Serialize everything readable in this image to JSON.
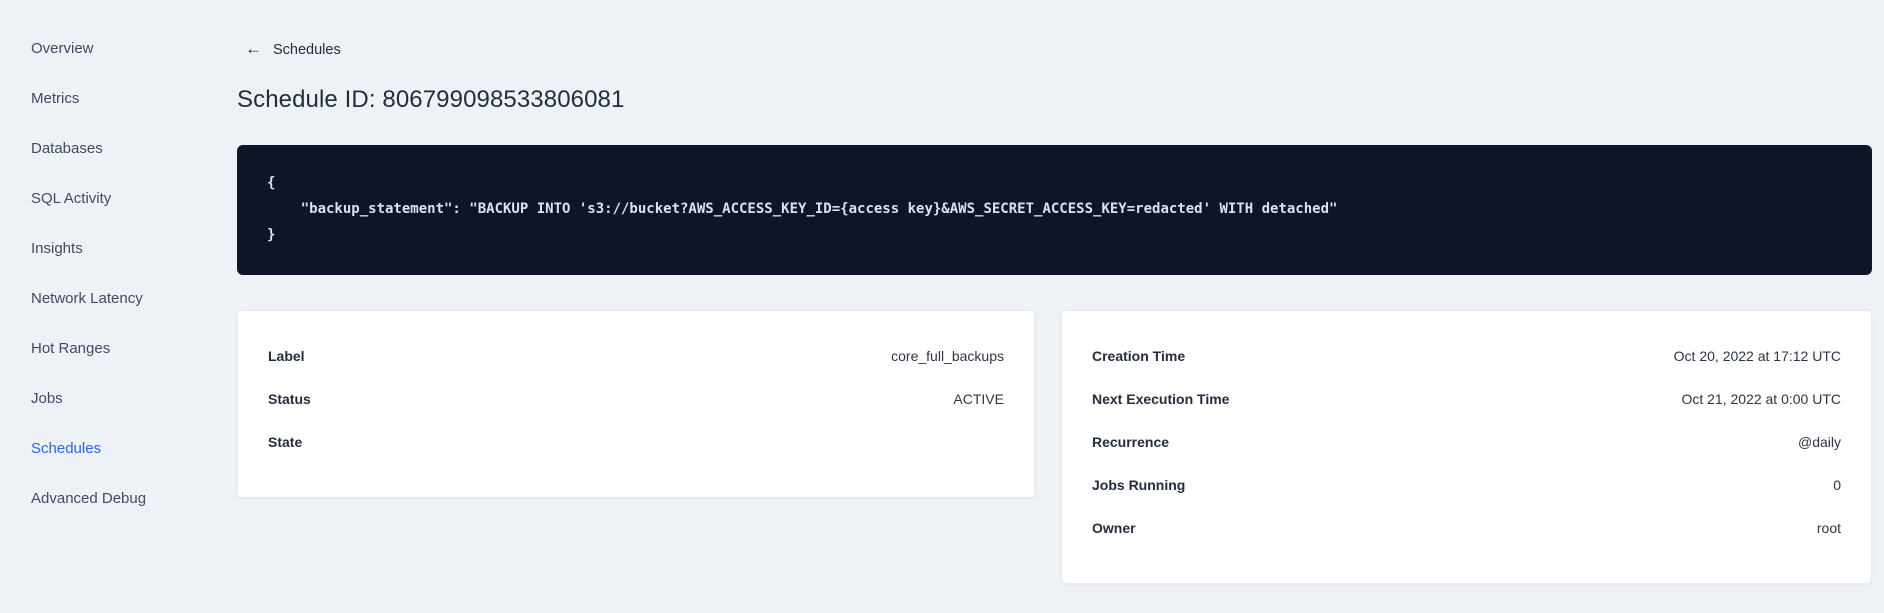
{
  "colors": {
    "page_background": "#eef2f6",
    "accent_active_link": "#2964ff",
    "code_background": "#0e1524",
    "code_text": "#dbe1ec",
    "card_background": "#ffffff"
  },
  "sidebar": {
    "items": [
      {
        "label": "Overview",
        "active": false
      },
      {
        "label": "Metrics",
        "active": false
      },
      {
        "label": "Databases",
        "active": false
      },
      {
        "label": "SQL Activity",
        "active": false
      },
      {
        "label": "Insights",
        "active": false
      },
      {
        "label": "Network Latency",
        "active": false
      },
      {
        "label": "Hot Ranges",
        "active": false
      },
      {
        "label": "Jobs",
        "active": false
      },
      {
        "label": "Schedules",
        "active": true
      },
      {
        "label": "Advanced Debug",
        "active": false
      }
    ]
  },
  "header": {
    "back_icon": "←",
    "back_label": "Schedules",
    "title": "Schedule ID: 806799098533806081"
  },
  "code_block": {
    "text": "{\n    \"backup_statement\": \"BACKUP INTO 's3://bucket?AWS_ACCESS_KEY_ID={access key}&AWS_SECRET_ACCESS_KEY=redacted' WITH detached\"\n}"
  },
  "details_card": {
    "rows": [
      {
        "label": "Label",
        "value": "core_full_backups"
      },
      {
        "label": "Status",
        "value": "ACTIVE"
      },
      {
        "label": "State",
        "value": ""
      }
    ]
  },
  "timing_card": {
    "rows": [
      {
        "label": "Creation Time",
        "value": "Oct 20, 2022 at 17:12 UTC"
      },
      {
        "label": "Next Execution Time",
        "value": "Oct 21, 2022 at 0:00 UTC"
      },
      {
        "label": "Recurrence",
        "value": "@daily"
      },
      {
        "label": "Jobs Running",
        "value": "0"
      },
      {
        "label": "Owner",
        "value": "root"
      }
    ]
  }
}
